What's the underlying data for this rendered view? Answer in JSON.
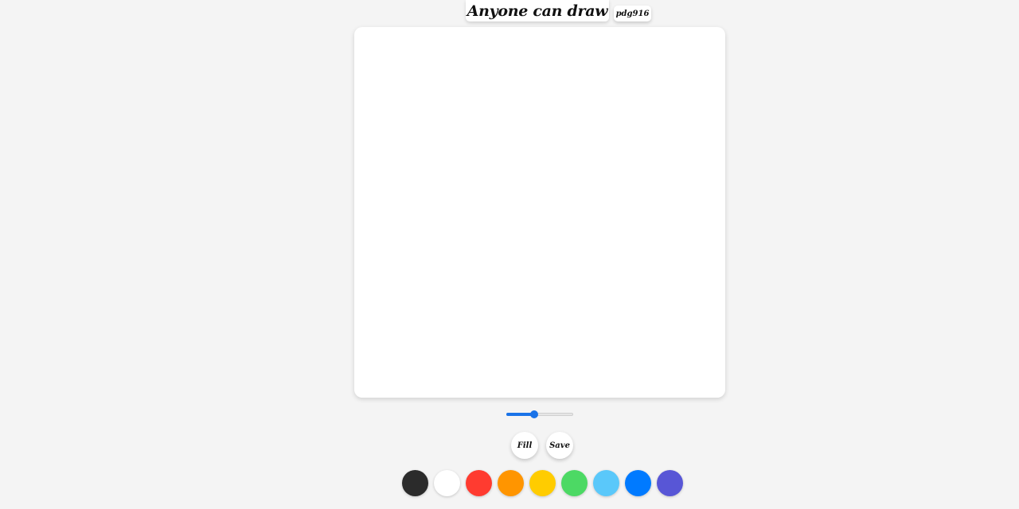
{
  "header": {
    "title": "Anyone can draw",
    "user": "pdg916"
  },
  "brush_size": {
    "value_fraction": 0.42
  },
  "actions": {
    "fill_label": "Fill",
    "save_label": "Save"
  },
  "palette": [
    {
      "name": "black",
      "color": "#2b2b2b"
    },
    {
      "name": "white",
      "color": "#ffffff"
    },
    {
      "name": "red",
      "color": "#ff3b30"
    },
    {
      "name": "orange",
      "color": "#ff9500"
    },
    {
      "name": "yellow",
      "color": "#ffcc00"
    },
    {
      "name": "green",
      "color": "#4cd964"
    },
    {
      "name": "light-blue",
      "color": "#5ac8fa"
    },
    {
      "name": "blue",
      "color": "#007aff"
    },
    {
      "name": "purple",
      "color": "#5856d6"
    }
  ]
}
